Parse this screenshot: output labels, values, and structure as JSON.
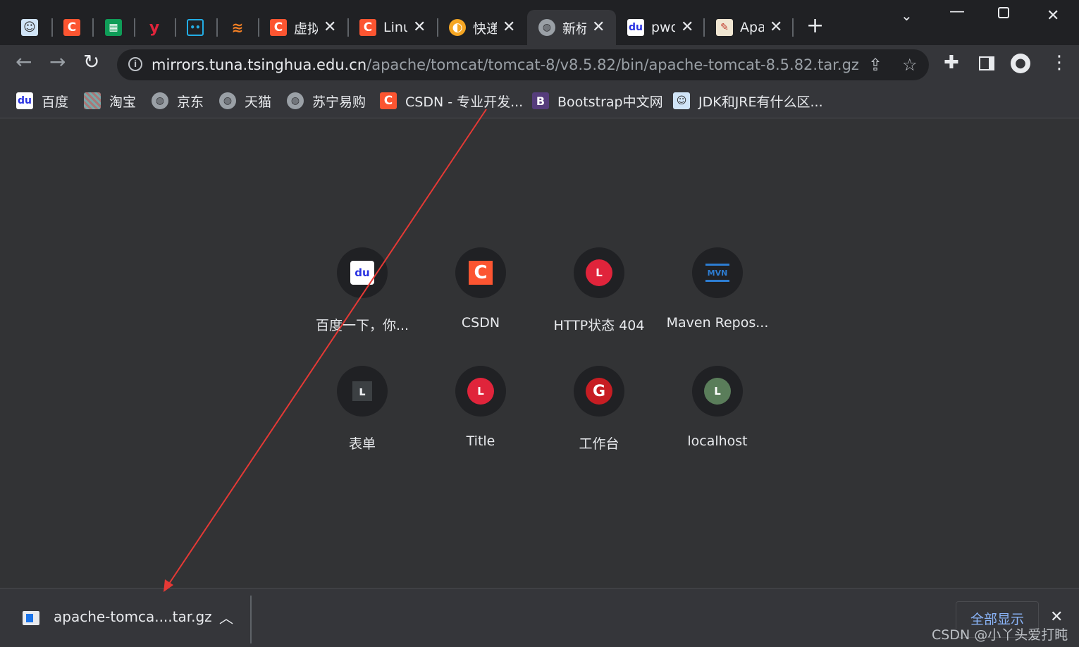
{
  "tabs": [
    {
      "title": "",
      "icon": "avatar-icon",
      "color": "#4a90d9",
      "glyph": "👤"
    },
    {
      "title": "",
      "icon": "csdn-icon",
      "color": "#fc5531",
      "glyph": "C"
    },
    {
      "title": "",
      "icon": "sheets-icon",
      "color": "#0f9d58",
      "glyph": "▦"
    },
    {
      "title": "",
      "icon": "youdao-icon",
      "color": "transparent",
      "glyph": "y"
    },
    {
      "title": "",
      "icon": "bilibili-icon",
      "color": "transparent",
      "glyph": "📺"
    },
    {
      "title": "",
      "icon": "stack-icon",
      "color": "transparent",
      "glyph": "≋"
    },
    {
      "title": "虚拟",
      "icon": "csdn-icon",
      "color": "#fc5531",
      "glyph": "C"
    },
    {
      "title": "Linu",
      "icon": "csdn-icon",
      "color": "#fc5531",
      "glyph": "C"
    },
    {
      "title": "快递",
      "icon": "kuaidi-icon",
      "color": "#f5a623",
      "glyph": "◐"
    },
    {
      "title": "新标",
      "icon": "globe-icon",
      "color": "transparent",
      "glyph": "🌐"
    },
    {
      "title": "pwd",
      "icon": "baidu-icon",
      "color": "#ffffff",
      "glyph": "🐾"
    },
    {
      "title": "Apa",
      "icon": "apache-icon",
      "color": "transparent",
      "glyph": "🪶"
    }
  ],
  "new_tab_glyph": "+",
  "toolbar": {
    "url_host": "mirrors.tuna.tsinghua.edu.cn",
    "url_path": "/apache/tomcat/tomcat-8/v8.5.82/bin/apache-tomcat-8.5.82.tar.gz"
  },
  "bookmarks": [
    {
      "label": "百度",
      "icon": "baidu-icon"
    },
    {
      "label": "淘宝",
      "icon": "taobao-icon"
    },
    {
      "label": "京东",
      "icon": "globe-icon"
    },
    {
      "label": "天猫",
      "icon": "globe-icon"
    },
    {
      "label": "苏宁易购",
      "icon": "globe-icon"
    },
    {
      "label": "CSDN - 专业开发...",
      "icon": "csdn-icon"
    },
    {
      "label": "Bootstrap中文网",
      "icon": "bootstrap-icon"
    },
    {
      "label": "JDK和JRE有什么区...",
      "icon": "avatar-icon"
    }
  ],
  "shortcuts": [
    {
      "label": "百度一下，你...",
      "icon": "baidu-icon"
    },
    {
      "label": "CSDN",
      "icon": "csdn-icon"
    },
    {
      "label": "HTTP状态 404",
      "icon": "letter-l-icon",
      "letter": "L",
      "color": "#e0243b"
    },
    {
      "label": "Maven Repos...",
      "icon": "maven-icon",
      "letter": "MVN"
    },
    {
      "label": "表单",
      "icon": "form-icon",
      "letter": "L"
    },
    {
      "label": "Title",
      "icon": "letter-l-icon",
      "letter": "L",
      "color": "#e0243b"
    },
    {
      "label": "工作台",
      "icon": "gitee-icon",
      "letter": "G"
    },
    {
      "label": "localhost",
      "icon": "letter-l-icon",
      "letter": "L",
      "color": "#5a7d5a"
    }
  ],
  "download": {
    "filename": "apache-tomca....tar.gz",
    "show_all": "全部显示"
  },
  "watermark": "CSDN @小丫头爱打盹",
  "colors": {
    "annotation_arrow": "#e53935",
    "link": "#8ab4f8"
  }
}
